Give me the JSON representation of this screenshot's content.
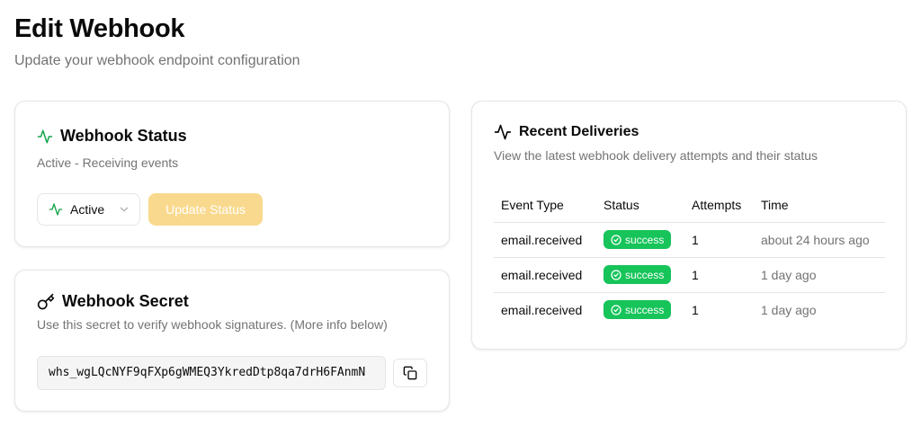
{
  "page": {
    "title": "Edit Webhook",
    "subtitle": "Update your webhook endpoint configuration"
  },
  "status_card": {
    "title": "Webhook Status",
    "description": "Active - Receiving events",
    "select_value": "Active",
    "update_button": "Update Status"
  },
  "secret_card": {
    "title": "Webhook Secret",
    "description": "Use this secret to verify webhook signatures. (More info below)",
    "secret_value": "whs_wgLQcNYF9qFXp6gWMEQ3YkredDtp8qa7drH6FAnmN"
  },
  "deliveries_card": {
    "title": "Recent Deliveries",
    "description": "View the latest webhook delivery attempts and their status",
    "columns": [
      "Event Type",
      "Status",
      "Attempts",
      "Time"
    ],
    "rows": [
      {
        "event": "email.received",
        "status": "success",
        "attempts": "1",
        "time": "about 24 hours ago"
      },
      {
        "event": "email.received",
        "status": "success",
        "attempts": "1",
        "time": "1 day ago"
      },
      {
        "event": "email.received",
        "status": "success",
        "attempts": "1",
        "time": "1 day ago"
      }
    ]
  },
  "colors": {
    "accent_green": "#16c45a",
    "activity_icon_green": "#16a34a",
    "update_button_disabled": "#f9d98d"
  },
  "icons": {
    "status_title": "activity-icon",
    "select": "activity-icon",
    "chevron": "chevron-down-icon",
    "secret_title": "key-icon",
    "copy": "copy-icon",
    "deliveries_title": "activity-icon",
    "badge": "check-circle-icon"
  }
}
